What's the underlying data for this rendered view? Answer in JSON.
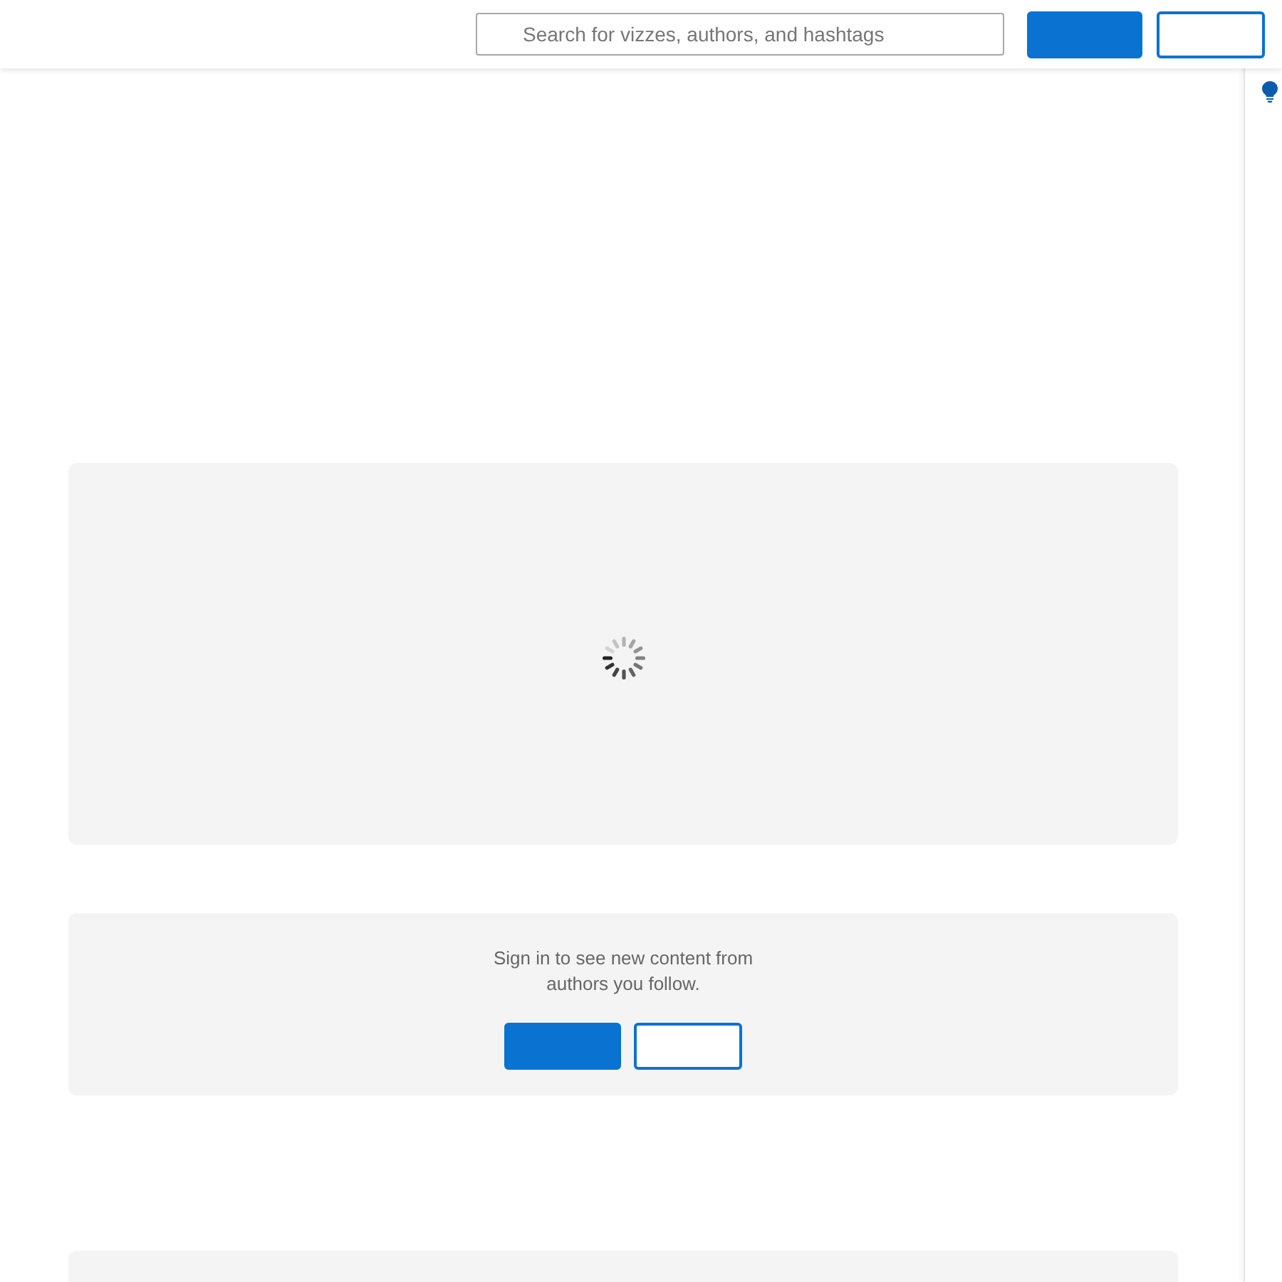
{
  "header": {
    "search": {
      "placeholder": "Search for vizzes, authors, and hashtags"
    },
    "buttons": [
      {
        "kind": "primary"
      },
      {
        "kind": "secondary"
      }
    ]
  },
  "feed": [
    {
      "kind": "loading"
    },
    {
      "kind": "sign_in_prompt",
      "message": "Sign in to see new content from authors you follow.",
      "buttons": [
        {
          "kind": "primary"
        },
        {
          "kind": "secondary"
        }
      ]
    },
    {
      "kind": "placeholder"
    }
  ]
}
